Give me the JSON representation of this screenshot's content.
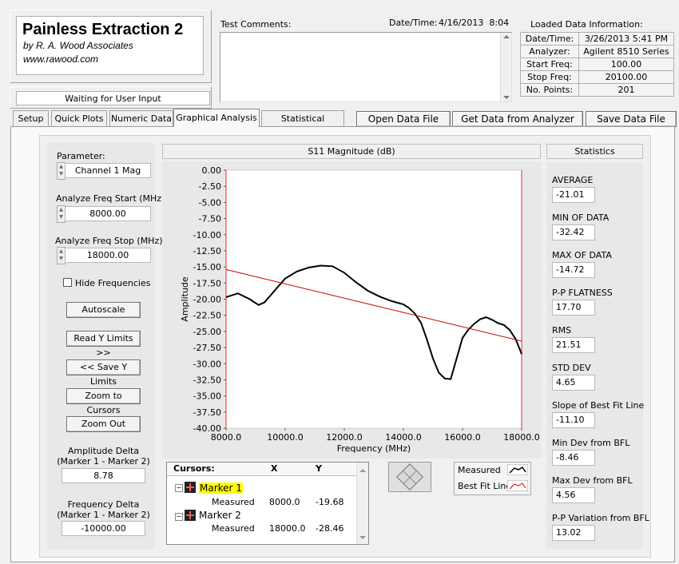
{
  "title_box": {
    "app_title": "Painless Extraction 2",
    "author": "by R. A. Wood Associates",
    "url": "www.rawood.com"
  },
  "status": "Waiting for User Input",
  "comments": {
    "label": "Test Comments:",
    "value": ""
  },
  "datetime": {
    "label": "Date/Time:",
    "value": "4/16/2013  8:04"
  },
  "loaded": {
    "title": "Loaded Data Information:",
    "rows": [
      {
        "label": "Date/Time:",
        "value": "3/26/2013 5:41 PM"
      },
      {
        "label": "Analyzer:",
        "value": "Agilent 8510 Series"
      },
      {
        "label": "Start Freq:",
        "value": "100.00"
      },
      {
        "label": "Stop Freq:",
        "value": "20100.00"
      },
      {
        "label": "No. Points:",
        "value": "201"
      }
    ]
  },
  "tabs": [
    "Setup",
    "Quick Plots",
    "Numeric Data",
    "Graphical Analysis",
    "Statistical Analysis"
  ],
  "active_tab": "Graphical Analysis",
  "actions": {
    "open": "Open Data File",
    "get": "Get Data from Analyzer",
    "save": "Save Data File"
  },
  "left": {
    "parameter_label": "Parameter:",
    "parameter_value": "Channel 1 Mag",
    "start_label": "Analyze Freq Start (MHz)",
    "start_value": "8000.00",
    "stop_label": "Analyze Freq Stop (MHz)",
    "stop_value": "18000.00",
    "hide_freq": "Hide Frequencies",
    "autoscale": "Autoscale",
    "read_y": "Read Y Limits >>",
    "save_y": "<< Save Y Limits",
    "zoom_cursors": "Zoom to Cursors",
    "zoom_out": "Zoom Out",
    "amp_delta_label1": "Amplitude Delta",
    "amp_delta_label2": "(Marker 1 - Marker 2)",
    "amp_delta_value": "8.78",
    "freq_delta_label1": "Frequency Delta",
    "freq_delta_label2": "(Marker 1 - Marker 2)",
    "freq_delta_value": "-10000.00"
  },
  "cursors": {
    "header": [
      "Cursors:",
      "X",
      "Y"
    ],
    "markers": [
      {
        "name": "Marker 1",
        "sub": "Measured",
        "x": "8000.0",
        "y": "-19.68"
      },
      {
        "name": "Marker 2",
        "sub": "Measured",
        "x": "18000.0",
        "y": "-28.46"
      }
    ]
  },
  "legend": {
    "measured": "Measured",
    "bestfit": "Best Fit Line"
  },
  "stats": {
    "title": "Statistics",
    "items": [
      {
        "label": "AVERAGE",
        "value": "-21.01"
      },
      {
        "label": "MIN OF DATA",
        "value": "-32.42"
      },
      {
        "label": "MAX OF DATA",
        "value": "-14.72"
      },
      {
        "label": "P-P FLATNESS",
        "value": "17.70"
      },
      {
        "label": "RMS",
        "value": "21.51"
      },
      {
        "label": "STD DEV",
        "value": "4.65"
      },
      {
        "label": "Slope of Best Fit Line",
        "value": "-11.10"
      },
      {
        "label": "Min Dev from BFL",
        "value": "-8.46"
      },
      {
        "label": "Max Dev from BFL",
        "value": "4.56"
      },
      {
        "label": "P-P Variation from BFL",
        "value": "13.02"
      }
    ]
  },
  "colors": {
    "measured": "#000000",
    "bestfit": "#cc0000",
    "marker_highlight": "#ffff00"
  },
  "chart_data": {
    "type": "line",
    "title": "S11 Magnitude (dB)",
    "xlabel": "Frequency (MHz)",
    "ylabel": "Amplitude",
    "xlim": [
      8000,
      18000
    ],
    "ylim": [
      -40,
      0
    ],
    "x_ticks": [
      "8000.0",
      "10000.0",
      "12000.0",
      "14000.0",
      "16000.0",
      "18000.0"
    ],
    "y_ticks": [
      "0.00",
      "-2.50",
      "-5.00",
      "-7.50",
      "-10.00",
      "-12.50",
      "-15.00",
      "-17.50",
      "-20.00",
      "-22.50",
      "-25.00",
      "-27.50",
      "-30.00",
      "-32.50",
      "-35.00",
      "-37.50",
      "-40.00"
    ],
    "grid": false,
    "series": [
      {
        "name": "Measured",
        "x": [
          8000,
          8400,
          8800,
          9100,
          9300,
          9600,
          10000,
          10400,
          10800,
          11200,
          11600,
          12000,
          12400,
          12800,
          13200,
          13600,
          14000,
          14200,
          14400,
          14600,
          14800,
          15000,
          15200,
          15400,
          15600,
          15800,
          16000,
          16200,
          16400,
          16600,
          16800,
          17000,
          17200,
          17400,
          17600,
          17800,
          18000
        ],
        "y": [
          -19.7,
          -19.1,
          -20.0,
          -20.9,
          -20.5,
          -18.9,
          -16.8,
          -15.7,
          -15.1,
          -14.8,
          -14.9,
          -15.9,
          -17.4,
          -18.7,
          -19.6,
          -20.3,
          -20.8,
          -21.4,
          -22.3,
          -23.7,
          -26.3,
          -29.2,
          -31.4,
          -32.3,
          -32.4,
          -29.2,
          -26.0,
          -24.7,
          -23.8,
          -23.1,
          -22.8,
          -23.2,
          -23.7,
          -24.0,
          -24.8,
          -26.2,
          -28.5
        ]
      },
      {
        "name": "Best Fit Line",
        "x": [
          8000,
          18000
        ],
        "y": [
          -15.4,
          -26.5
        ]
      }
    ]
  }
}
